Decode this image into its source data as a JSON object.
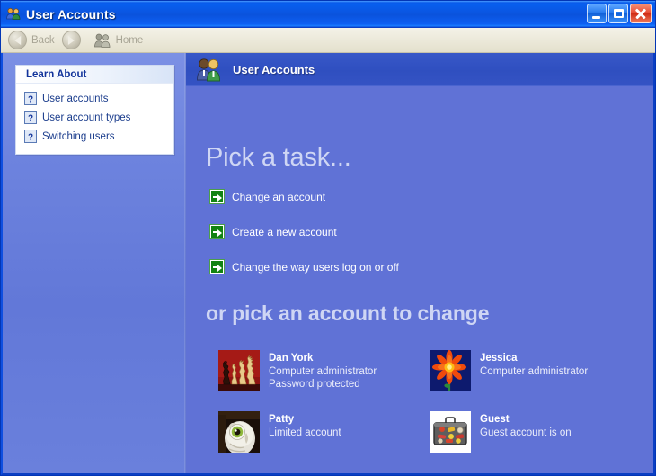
{
  "window": {
    "title": "User Accounts",
    "title_icon": "users-icon",
    "buttons": {
      "minimize": "minimize-button",
      "maximize": "maximize-button",
      "close": "close-button"
    }
  },
  "toolbar": {
    "back_label": "Back",
    "back_icon": "back-arrow-icon",
    "forward_icon": "forward-arrow-icon",
    "home_label": "Home",
    "home_icon": "home-users-icon"
  },
  "sidebar": {
    "panel_title": "Learn About",
    "items": [
      {
        "label": "User accounts",
        "icon": "help-question-icon"
      },
      {
        "label": "User account types",
        "icon": "help-question-icon"
      },
      {
        "label": "Switching users",
        "icon": "help-question-icon"
      }
    ]
  },
  "main": {
    "banner_title": "User Accounts",
    "banner_icon": "two-users-icon",
    "heading_tasks": "Pick a task...",
    "heading_accounts": "or pick an account to change",
    "tasks": [
      {
        "label": "Change an account",
        "icon": "green-arrow-icon"
      },
      {
        "label": "Create a new account",
        "icon": "green-arrow-icon"
      },
      {
        "label": "Change the way users log on or off",
        "icon": "green-arrow-icon"
      }
    ],
    "accounts": [
      {
        "name": "Dan York",
        "lines": [
          "Computer administrator",
          "Password protected"
        ],
        "picture": "chess-pieces-picture"
      },
      {
        "name": "Jessica",
        "lines": [
          "Computer administrator"
        ],
        "picture": "orange-flower-picture"
      },
      {
        "name": "Patty",
        "lines": [
          "Limited account"
        ],
        "picture": "owl-picture"
      },
      {
        "name": "Guest",
        "lines": [
          "Guest account is on"
        ],
        "picture": "suitcase-picture"
      }
    ]
  },
  "colors": {
    "titlebar_blue": "#0a55e0",
    "content_blue": "#6072d6",
    "sidebar_blue": "#6d83de",
    "banner_blue": "#2f4fc0",
    "green_accent": "#128312",
    "heading_text": "#cfd6f4",
    "panel_title_text": "#12349b",
    "link_text": "#1a3c8c"
  }
}
